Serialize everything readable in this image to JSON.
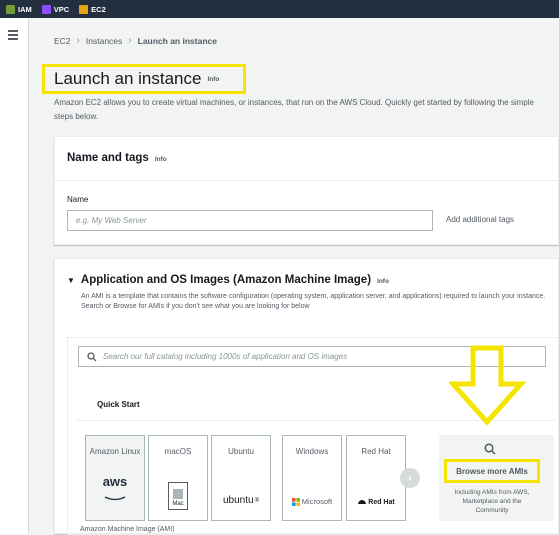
{
  "topbar": {
    "services": [
      {
        "label": "IAM",
        "icon": "iam-service-icon",
        "color": "#759c3e"
      },
      {
        "label": "VPC",
        "icon": "vpc-service-icon",
        "color": "#8c4fff"
      },
      {
        "label": "EC2",
        "icon": "ec2-service-icon",
        "color": "#e7a417"
      }
    ]
  },
  "sidebar": {
    "menu_icon": "hamburger-menu-icon"
  },
  "breadcrumb": {
    "items": [
      "EC2",
      "Instances",
      "Launch an instance"
    ]
  },
  "page": {
    "title": "Launch an instance",
    "title_info": "Info",
    "intro": "Amazon EC2 allows you to create virtual machines, or instances, that run on the AWS Cloud. Quickly get started by following the simple steps below."
  },
  "name_tags": {
    "header": "Name and tags",
    "info": "Info",
    "name_label": "Name",
    "name_placeholder": "e.g. My Web Server",
    "name_value": "",
    "add_tags": "Add additional tags"
  },
  "ami": {
    "header": "Application and OS Images (Amazon Machine Image)",
    "info": "Info",
    "description": "An AMI is a template that contains the software configuration (operating system, application server, and applications) required to launch your instance. Search or Browse for AMIs if you don't see what you are looking for below",
    "search_placeholder": "Search our full catalog including 1000s of application and OS images",
    "tab": "Quick Start",
    "tiles": [
      {
        "name": "Amazon Linux",
        "logo": "aws"
      },
      {
        "name": "macOS",
        "logo": "Mac"
      },
      {
        "name": "Ubuntu",
        "logo": "ubuntu"
      },
      {
        "name": "Windows",
        "logo": "Microsoft"
      },
      {
        "name": "Red Hat",
        "logo": "Red Hat"
      }
    ],
    "browse_more": "Browse more AMIs",
    "browse_sub": "Including AMIs from AWS, Marketplace and the Community",
    "ami_label": "Amazon Machine Image (AMI)"
  },
  "annotations": {
    "highlight_color": "#f5e400"
  }
}
